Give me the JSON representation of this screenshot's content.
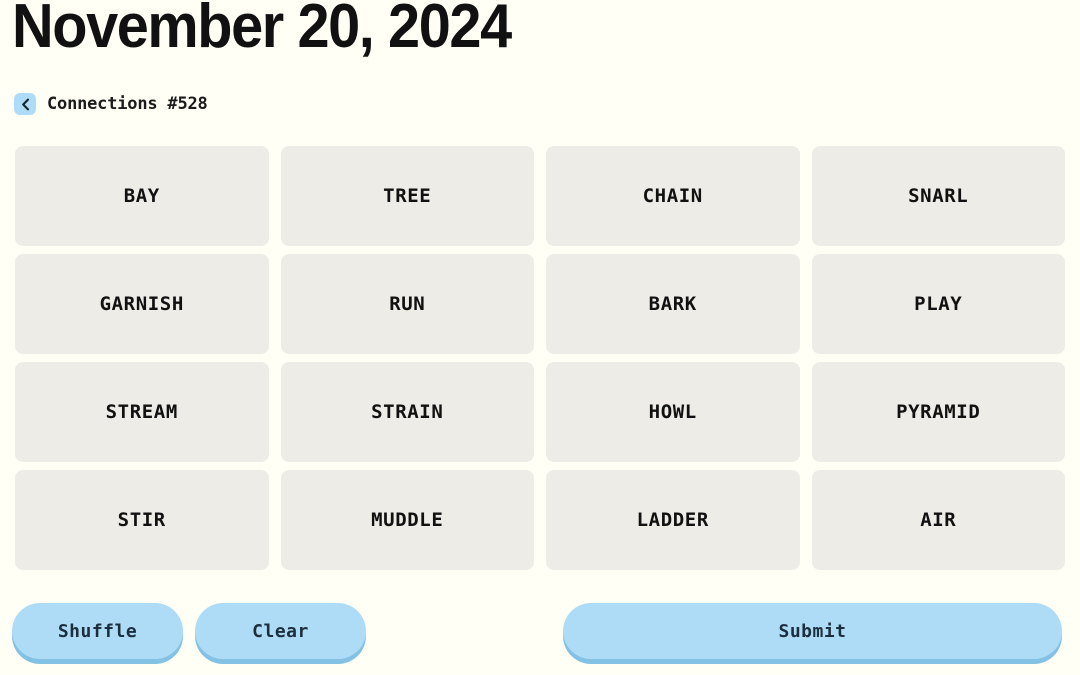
{
  "header": {
    "title": "November 20, 2024",
    "back_icon": "chevron-left-icon",
    "subtitle": "Connections #528"
  },
  "grid": {
    "tiles": [
      "BAY",
      "TREE",
      "CHAIN",
      "SNARL",
      "GARNISH",
      "RUN",
      "BARK",
      "PLAY",
      "STREAM",
      "STRAIN",
      "HOWL",
      "PYRAMID",
      "STIR",
      "MUDDLE",
      "LADDER",
      "AIR"
    ]
  },
  "controls": {
    "shuffle_label": "Shuffle",
    "clear_label": "Clear",
    "submit_label": "Submit"
  },
  "colors": {
    "background": "#fffff6",
    "tile": "#edece6",
    "accent_blue": "#aedcf7",
    "accent_blue_shadow": "#83c2e4",
    "text_dark": "#111111",
    "button_text": "#1d2f3d"
  }
}
